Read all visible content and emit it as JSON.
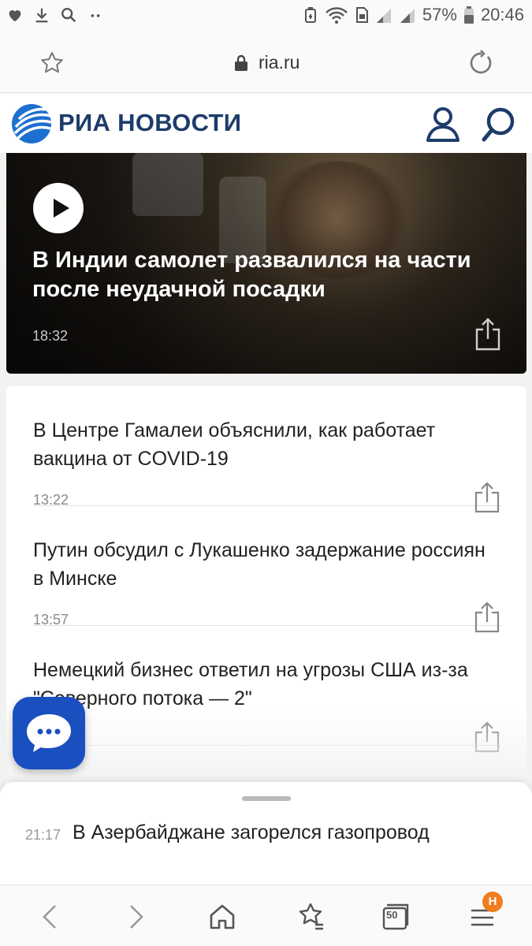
{
  "status_bar": {
    "battery": "57%",
    "time": "20:46"
  },
  "browser": {
    "url": "ria.ru",
    "tabs_count": "50",
    "menu_badge": "H"
  },
  "site": {
    "logo_text": "РИА НОВОСТИ",
    "brand_color": "#1d3c6b"
  },
  "hero": {
    "title": "В Индии самолет развалился на части после неудачной посадки",
    "time": "18:32"
  },
  "news": [
    {
      "title": "В Центре Гамалеи объяснили, как работает вакцина от COVID-19",
      "time": "13:22"
    },
    {
      "title": "Путин обсудил с Лукашенко задержание россиян в Минске",
      "time": "13:57"
    },
    {
      "title": "Немецкий бизнес ответил на угрозы США из-за \"Северного потока — 2\"",
      "time": ""
    }
  ],
  "sheet": {
    "time": "21:17",
    "title": "В Азербайджане загорелся газопровод"
  },
  "colors": {
    "chat_button": "#1a4fc0",
    "badge": "#f07d1e"
  }
}
